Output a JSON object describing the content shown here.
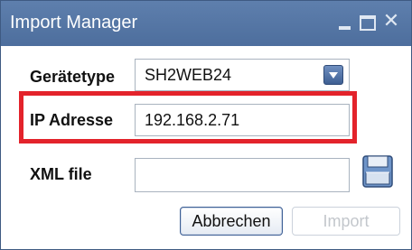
{
  "window": {
    "title": "Import Manager",
    "controls": {
      "close": "✕"
    }
  },
  "form": {
    "device_type": {
      "label": "Gerätetype",
      "value": "SH2WEB24"
    },
    "ip_address": {
      "label": "IP Adresse",
      "value": "192.168.2.71"
    },
    "xml_file": {
      "label": "XML file",
      "value": "",
      "placeholder": ""
    }
  },
  "buttons": {
    "cancel": "Abbrechen",
    "import": "Import"
  },
  "colors": {
    "titlebar": "#5577a6",
    "highlight": "#e3232b",
    "accent": "#3e5f93"
  },
  "icons": {
    "dropdown": "chevron-down-icon",
    "file_browse": "folder-icon"
  }
}
